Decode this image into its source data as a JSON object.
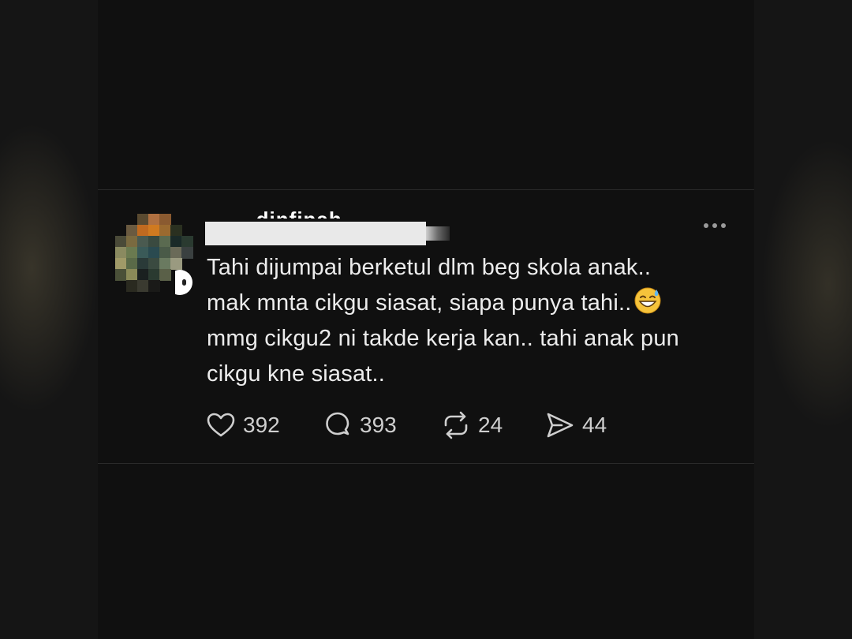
{
  "post": {
    "username": "...dinfinah...",
    "content_lines": [
      "Tahi dijumpai berketul dlm beg skola anak..",
      "mak mnta cikgu siasat, siapa punya tahi..",
      "mmg cikgu2 ni takde kerja kan.. tahi anak pun",
      "cikgu kne siasat.."
    ],
    "emoji_name": "grinning-face-with-sweat-emoji",
    "actions": {
      "likes": "392",
      "replies": "393",
      "reposts": "24",
      "shares": "44"
    },
    "icons": {
      "like": "heart-icon",
      "reply": "speech-bubble-icon",
      "repost": "repost-icon",
      "share": "send-icon",
      "more": "more-dots-icon"
    }
  },
  "colors": {
    "background": "#151515",
    "post_background": "#101010",
    "text": "#ececec",
    "muted": "#cfcfcf"
  }
}
